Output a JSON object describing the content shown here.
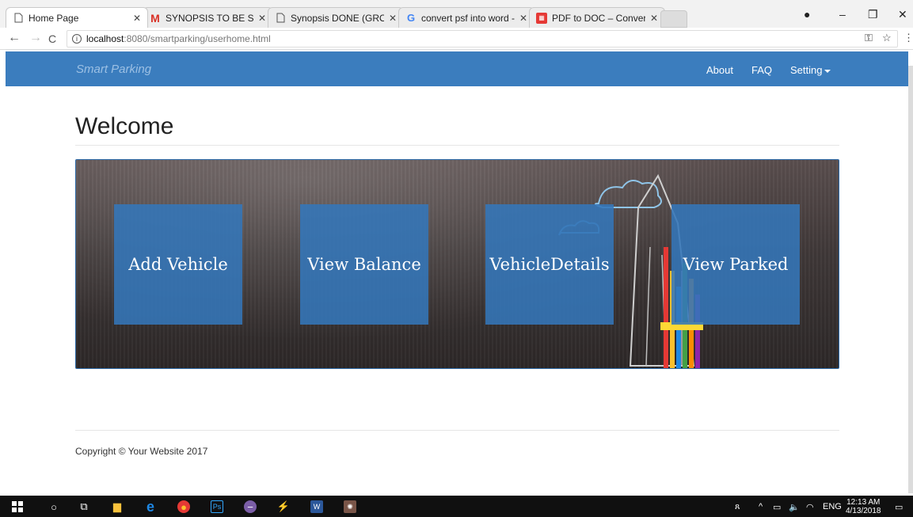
{
  "browser": {
    "tabs": [
      {
        "title": "Home Page",
        "icon": "page-icon",
        "active": true
      },
      {
        "title": "SYNOPSIS TO BE SUBMIT",
        "icon": "gmail-icon",
        "active": false
      },
      {
        "title": "Synopsis DONE (GROUP",
        "icon": "page-icon",
        "active": false
      },
      {
        "title": "convert psf into word - G",
        "icon": "google-icon",
        "active": false
      },
      {
        "title": "PDF to DOC – Convert PI",
        "icon": "pdf-icon",
        "active": false
      }
    ],
    "url_host": "localhost",
    "url_path": ":8080/smartparking/userhome.html"
  },
  "navbar": {
    "brand": "Smart Parking",
    "items": [
      {
        "label": "About"
      },
      {
        "label": "FAQ"
      },
      {
        "label": "Setting"
      }
    ]
  },
  "main": {
    "title": "Welcome",
    "tiles": [
      {
        "label": "Add Vehicle"
      },
      {
        "label": "View Balance"
      },
      {
        "label": "VehicleDetails"
      },
      {
        "label": "View Parked"
      }
    ]
  },
  "footer": {
    "copyright": "Copyright © Your Website 2017"
  },
  "taskbar": {
    "language": "ENG",
    "time": "12:13 AM",
    "date": "4/13/2018"
  },
  "colors": {
    "navbar": "#3b7dbe",
    "tile": "#3476ba"
  }
}
